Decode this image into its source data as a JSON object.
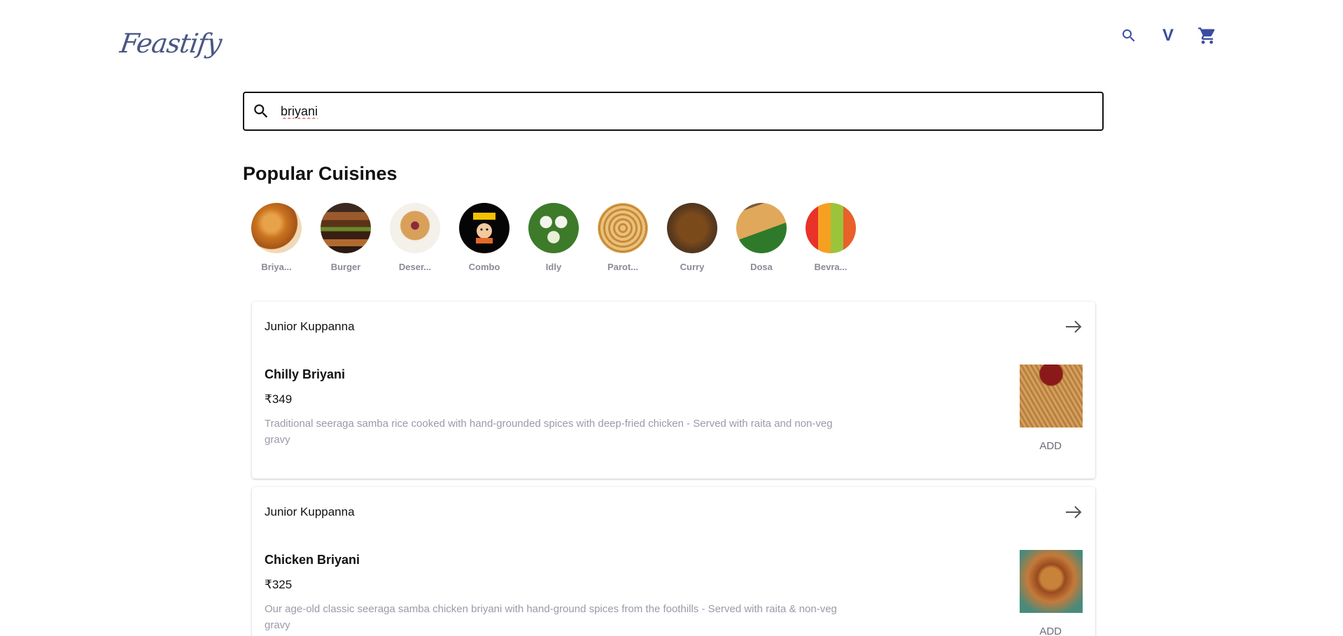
{
  "header": {
    "logo_text": "Feastify",
    "user_initial": "V"
  },
  "search": {
    "value": "briyani",
    "placeholder": ""
  },
  "cuisines": {
    "title": "Popular Cuisines",
    "items": [
      {
        "label": "Briya..."
      },
      {
        "label": "Burger"
      },
      {
        "label": "Deser..."
      },
      {
        "label": "Combo"
      },
      {
        "label": "Idly"
      },
      {
        "label": "Parot..."
      },
      {
        "label": "Curry"
      },
      {
        "label": "Dosa"
      },
      {
        "label": "Bevra..."
      }
    ]
  },
  "results": [
    {
      "restaurant": "Junior Kuppanna",
      "dish": "Chilly Briyani",
      "price": "₹349",
      "description": "Traditional seeraga samba rice cooked with hand-grounded spices with deep-fried chicken - Served with raita and non-veg gravy",
      "add_label": "ADD"
    },
    {
      "restaurant": "Junior Kuppanna",
      "dish": "Chicken Briyani",
      "price": "₹325",
      "description": "Our age-old classic seeraga samba chicken briyani with hand-ground spices from the foothills - Served with raita & non-veg gravy",
      "add_label": "ADD"
    }
  ],
  "colors": {
    "accent": "#3a4ca0",
    "logo": "#4a5785",
    "muted_text": "#9a9aa8"
  },
  "icons": [
    "search-icon",
    "cart-icon",
    "arrow-right-icon"
  ]
}
